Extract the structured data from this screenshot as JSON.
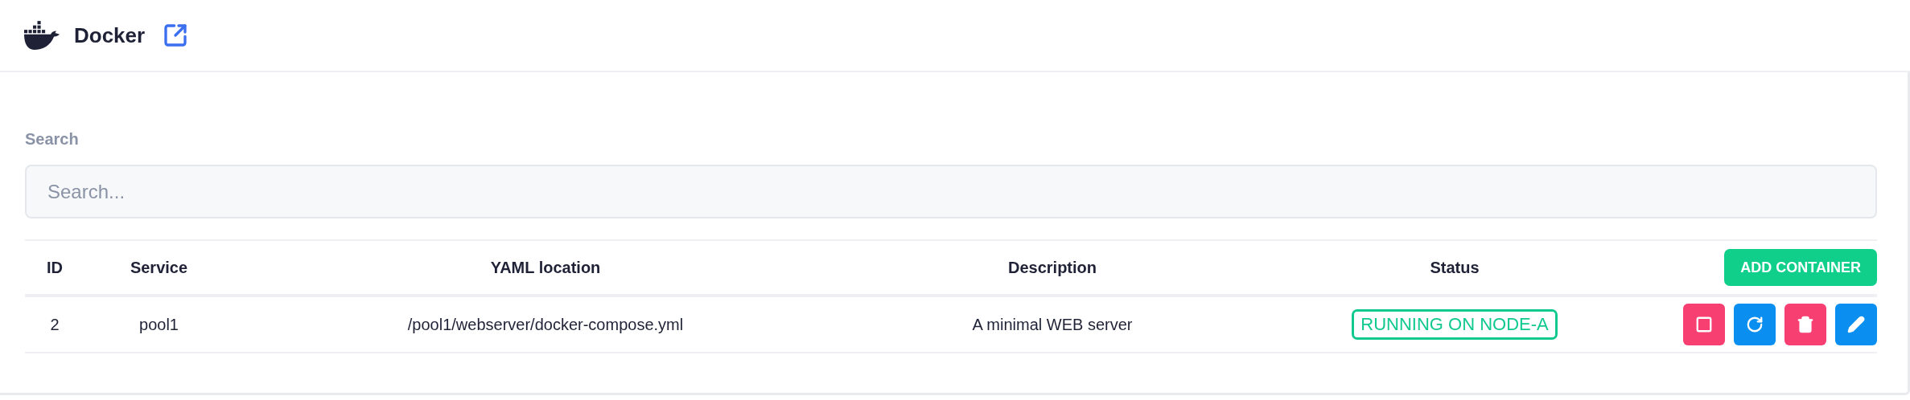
{
  "header": {
    "title": "Docker"
  },
  "search": {
    "label": "Search",
    "placeholder": "Search..."
  },
  "table": {
    "columns": [
      "ID",
      "Service",
      "YAML location",
      "Description",
      "Status"
    ],
    "add_button": "ADD CONTAINER",
    "rows": [
      {
        "id": "2",
        "service": "pool1",
        "yaml": "/pool1/webserver/docker-compose.yml",
        "description": "A minimal WEB server",
        "status": {
          "text": "RUNNING ON NODE-A",
          "kind": "running"
        },
        "actions": [
          {
            "kind": "stop"
          },
          {
            "kind": "restart"
          },
          {
            "kind": "delete"
          },
          {
            "kind": "edit"
          }
        ]
      }
    ]
  }
}
